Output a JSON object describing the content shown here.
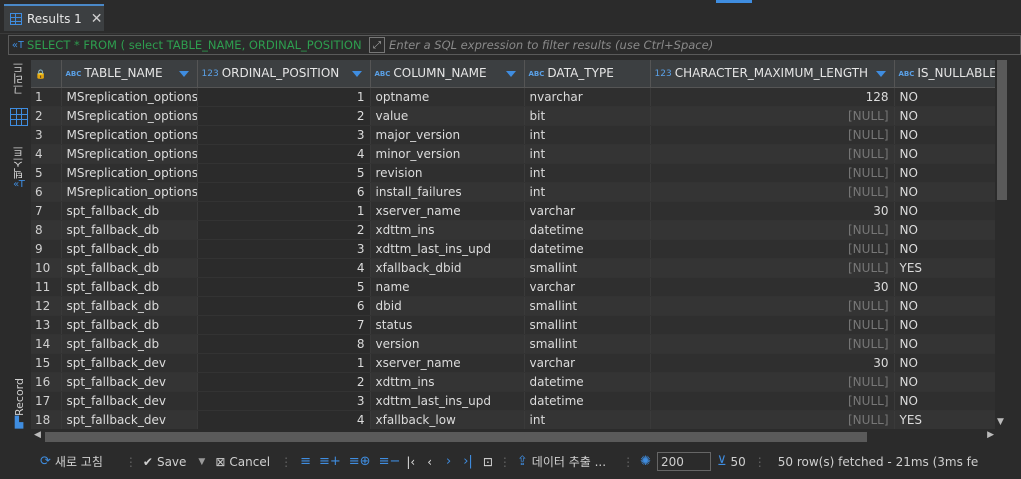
{
  "tab": {
    "label": "Results 1"
  },
  "filter": {
    "sql": "SELECT * FROM ( select TABLE_NAME, ORDINAL_POSITION , C",
    "placeholder": "Enter a SQL expression to filter results (use Ctrl+Space)"
  },
  "sidebar": {
    "grid_label": "그리드",
    "text_label": "텍스트",
    "record_label": "Record"
  },
  "columns": [
    {
      "tag": "ABC",
      "name": "TABLE_NAME"
    },
    {
      "tag": "123",
      "name": "ORDINAL_POSITION"
    },
    {
      "tag": "ABC",
      "name": "COLUMN_NAME"
    },
    {
      "tag": "ABC",
      "name": "DATA_TYPE"
    },
    {
      "tag": "123",
      "name": "CHARACTER_MAXIMUM_LENGTH"
    },
    {
      "tag": "ABC",
      "name": "IS_NULLABLE"
    }
  ],
  "rows": [
    [
      "1",
      "MSreplication_options",
      "1",
      "optname",
      "nvarchar",
      "128",
      "NO"
    ],
    [
      "2",
      "MSreplication_options",
      "2",
      "value",
      "bit",
      "[NULL]",
      "NO"
    ],
    [
      "3",
      "MSreplication_options",
      "3",
      "major_version",
      "int",
      "[NULL]",
      "NO"
    ],
    [
      "4",
      "MSreplication_options",
      "4",
      "minor_version",
      "int",
      "[NULL]",
      "NO"
    ],
    [
      "5",
      "MSreplication_options",
      "5",
      "revision",
      "int",
      "[NULL]",
      "NO"
    ],
    [
      "6",
      "MSreplication_options",
      "6",
      "install_failures",
      "int",
      "[NULL]",
      "NO"
    ],
    [
      "7",
      "spt_fallback_db",
      "1",
      "xserver_name",
      "varchar",
      "30",
      "NO"
    ],
    [
      "8",
      "spt_fallback_db",
      "2",
      "xdttm_ins",
      "datetime",
      "[NULL]",
      "NO"
    ],
    [
      "9",
      "spt_fallback_db",
      "3",
      "xdttm_last_ins_upd",
      "datetime",
      "[NULL]",
      "NO"
    ],
    [
      "10",
      "spt_fallback_db",
      "4",
      "xfallback_dbid",
      "smallint",
      "[NULL]",
      "YES"
    ],
    [
      "11",
      "spt_fallback_db",
      "5",
      "name",
      "varchar",
      "30",
      "NO"
    ],
    [
      "12",
      "spt_fallback_db",
      "6",
      "dbid",
      "smallint",
      "[NULL]",
      "NO"
    ],
    [
      "13",
      "spt_fallback_db",
      "7",
      "status",
      "smallint",
      "[NULL]",
      "NO"
    ],
    [
      "14",
      "spt_fallback_db",
      "8",
      "version",
      "smallint",
      "[NULL]",
      "NO"
    ],
    [
      "15",
      "spt_fallback_dev",
      "1",
      "xserver_name",
      "varchar",
      "30",
      "NO"
    ],
    [
      "16",
      "spt_fallback_dev",
      "2",
      "xdttm_ins",
      "datetime",
      "[NULL]",
      "NO"
    ],
    [
      "17",
      "spt_fallback_dev",
      "3",
      "xdttm_last_ins_upd",
      "datetime",
      "[NULL]",
      "NO"
    ],
    [
      "18",
      "spt_fallback_dev",
      "4",
      "xfallback_low",
      "int",
      "[NULL]",
      "YES"
    ]
  ],
  "toolbar": {
    "refresh": "새로 고침",
    "save": "Save",
    "cancel": "Cancel",
    "export": "데이터 추출 ...",
    "limit": "200",
    "fetch_size": "50",
    "status": "50 row(s) fetched - 21ms (3ms fe"
  },
  "colors": {
    "accent": "#3f8de0",
    "sql_text": "#2e9e4f",
    "null_text": "#777777"
  }
}
